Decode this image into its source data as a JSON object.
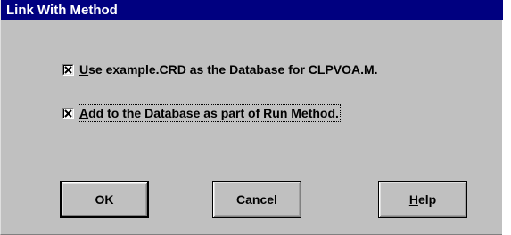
{
  "dialog": {
    "title": "Link With Method"
  },
  "options": [
    {
      "accel": "U",
      "rest": "se example.CRD as the Database for CLPVOA.M.",
      "checked": true
    },
    {
      "accel": "A",
      "rest": "dd to the Database as part of Run Method.",
      "checked": true
    }
  ],
  "buttons": {
    "ok": "OK",
    "cancel": "Cancel",
    "help_accel": "H",
    "help_rest": "elp"
  },
  "icons": {
    "check": "check-icon"
  },
  "colors": {
    "titlebar": "#000080",
    "dialog_bg": "#c0c0c0"
  }
}
